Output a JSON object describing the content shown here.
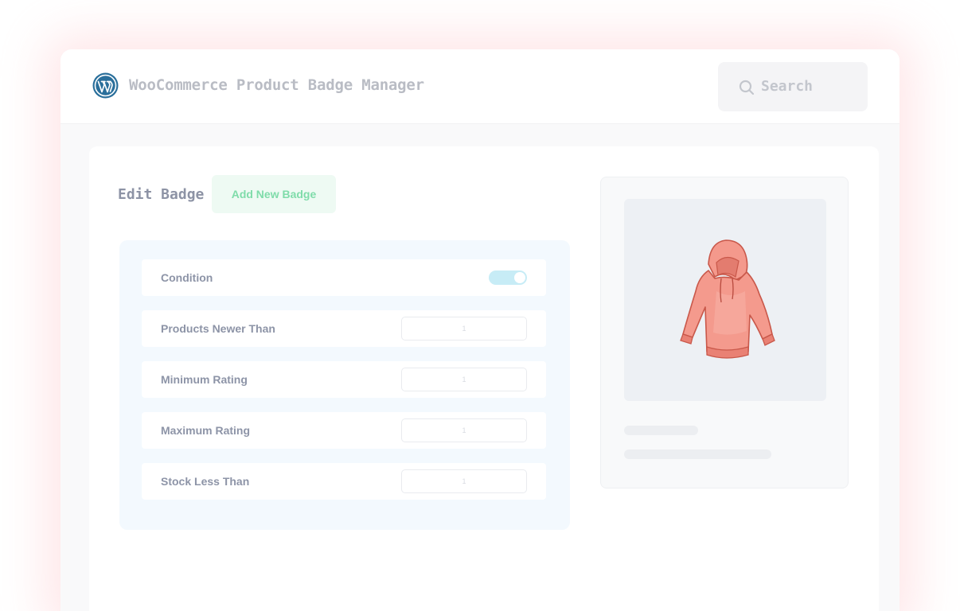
{
  "header": {
    "logo_icon": "wordpress-logo-icon",
    "title": "WooCommerce Product Badge Manager",
    "search": {
      "icon": "search-icon",
      "placeholder": "Search"
    }
  },
  "editor": {
    "title": "Edit Badge",
    "add_button_label": "Add New Badge",
    "rows": [
      {
        "label": "Condition",
        "control": "toggle",
        "enabled": true
      },
      {
        "label": "Products Newer Than",
        "control": "number",
        "value": "1"
      },
      {
        "label": "Minimum Rating",
        "control": "number",
        "value": "1"
      },
      {
        "label": "Maximum Rating",
        "control": "number",
        "value": "1"
      },
      {
        "label": "Stock Less Than",
        "control": "number",
        "value": "1"
      }
    ]
  },
  "preview": {
    "image_icon": "hoodie-product-image"
  },
  "colors": {
    "accent_green": "#7fdcaa",
    "toggle_on": "#c7ecf6",
    "hoodie": "#f28c7f"
  }
}
